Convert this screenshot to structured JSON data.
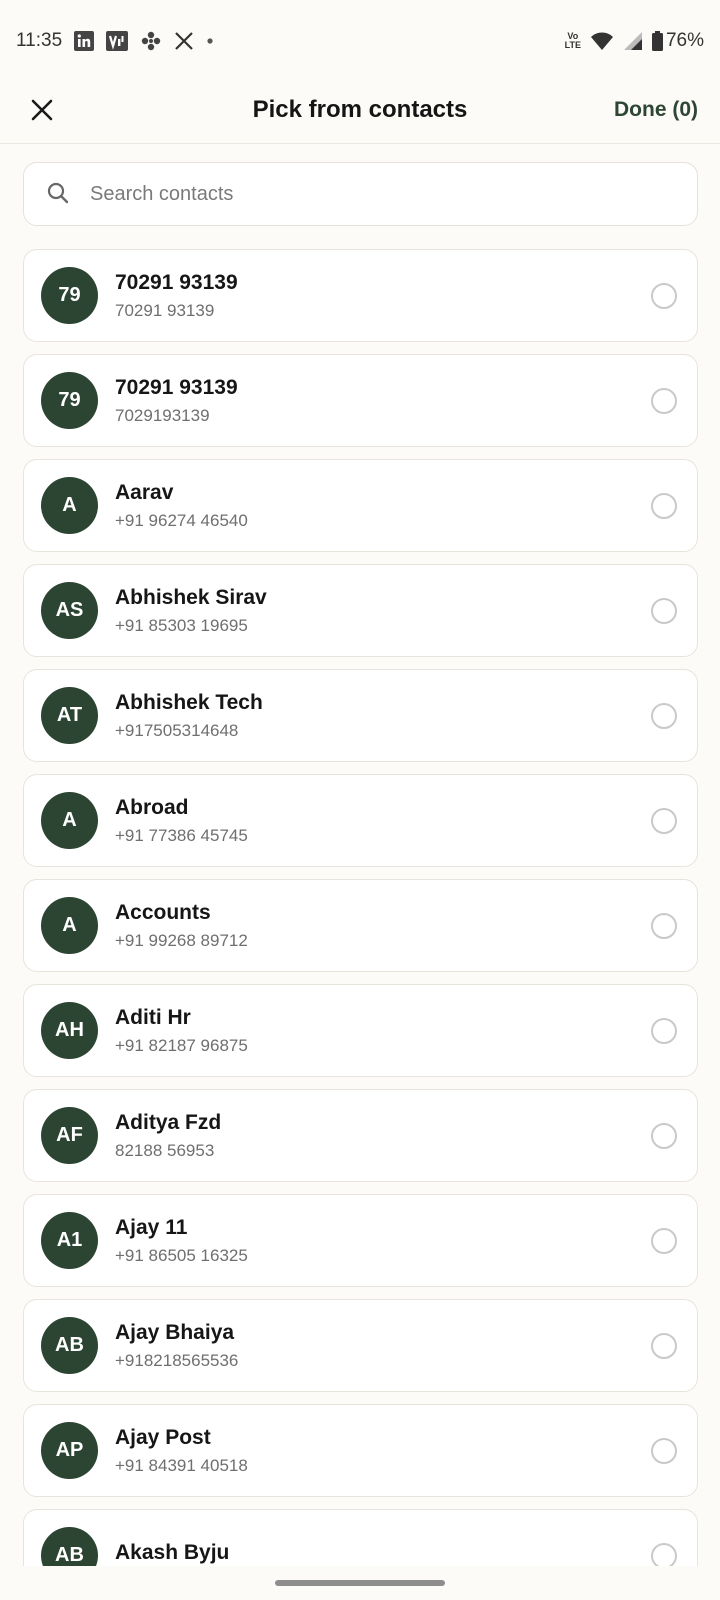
{
  "status_bar": {
    "time": "11:35",
    "notification_icons": [
      "linkedin-icon",
      "vi-icon",
      "pinwheel-icon",
      "x-icon",
      "dot-icon"
    ],
    "volte_top": "Vo",
    "volte_bottom": "LTE",
    "battery": "76%"
  },
  "header": {
    "title": "Pick from contacts",
    "done_label": "Done (0)"
  },
  "search": {
    "placeholder": "Search contacts",
    "value": ""
  },
  "contacts": [
    {
      "initials": "79",
      "name": "70291 93139",
      "phone": "70291 93139",
      "selected": false
    },
    {
      "initials": "79",
      "name": "70291 93139",
      "phone": "7029193139",
      "selected": false
    },
    {
      "initials": "A",
      "name": "Aarav",
      "phone": "+91 96274 46540",
      "selected": false
    },
    {
      "initials": "AS",
      "name": "Abhishek Sirav",
      "phone": "+91 85303 19695",
      "selected": false
    },
    {
      "initials": "AT",
      "name": "Abhishek Tech",
      "phone": "+917505314648",
      "selected": false
    },
    {
      "initials": "A",
      "name": "Abroad",
      "phone": "+91 77386 45745",
      "selected": false
    },
    {
      "initials": "A",
      "name": "Accounts",
      "phone": "+91 99268 89712",
      "selected": false
    },
    {
      "initials": "AH",
      "name": "Aditi Hr",
      "phone": "+91 82187 96875",
      "selected": false
    },
    {
      "initials": "AF",
      "name": "Aditya Fzd",
      "phone": "82188 56953",
      "selected": false
    },
    {
      "initials": "A1",
      "name": "Ajay 11",
      "phone": "+91 86505 16325",
      "selected": false
    },
    {
      "initials": "AB",
      "name": "Ajay Bhaiya",
      "phone": "+918218565536",
      "selected": false
    },
    {
      "initials": "AP",
      "name": "Ajay Post",
      "phone": "+91 84391 40518",
      "selected": false
    },
    {
      "initials": "AB",
      "name": "Akash Byju",
      "phone": "",
      "selected": false
    }
  ],
  "colors": {
    "accent": "#2e4634",
    "avatar_bg": "#2c4432",
    "background": "#fcfbf7"
  }
}
